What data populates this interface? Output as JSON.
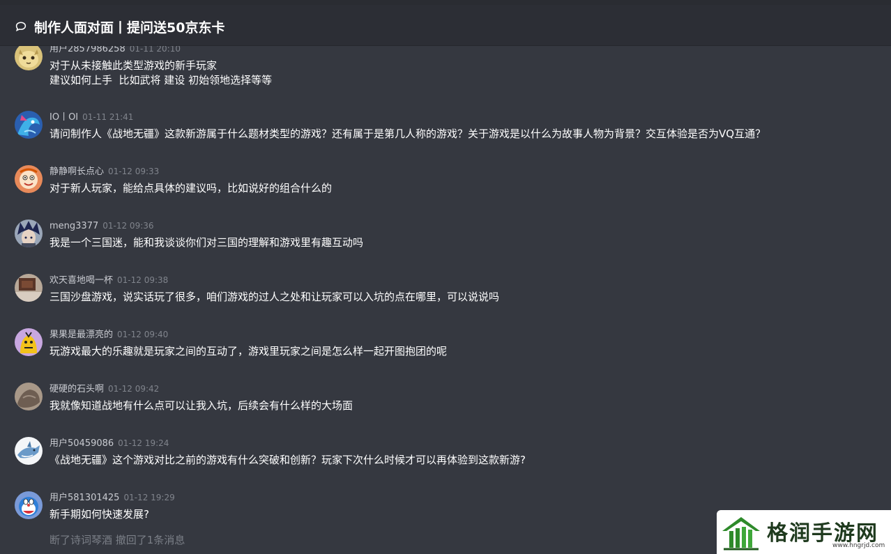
{
  "header": {
    "title": "制作人面对面丨提问送50京东卡",
    "icon": "chat-bubble-icon"
  },
  "messages": [
    {
      "username": "用户2857986258",
      "time": "01-11 20:10",
      "content": "对于从未接触此类型游戏的新手玩家\n建议如何上手  比如武将 建设 初始领地选择等等",
      "avatar": "cat-face-avatar",
      "avatar_color": "#d9c27a"
    },
    {
      "username": "IO丨OI",
      "time": "01-11 21:41",
      "content": "请问制作人《战地无疆》这款新游属于什么题材类型的游戏？还有属于是第几人称的游戏？关于游戏是以什么为故事人物为背景？交互体验是否为VQ互通？",
      "avatar": "blue-dragon-avatar",
      "avatar_color": "#3a7fd0"
    },
    {
      "username": "静静啊长点心",
      "time": "01-12 09:33",
      "content": "对于新人玩家，能给点具体的建议吗，比如说好的组合什么的",
      "avatar": "cartoon-face-avatar",
      "avatar_color": "#e88a5a"
    },
    {
      "username": "meng3377",
      "time": "01-12 09:36",
      "content": "我是一个三国迷，能和我谈谈你们对三国的理解和游戏里有趣互动吗",
      "avatar": "anime-boy-avatar",
      "avatar_color": "#2e3a66"
    },
    {
      "username": "欢天喜地喝一杯",
      "time": "01-12 09:38",
      "content": "三国沙盘游戏，说实话玩了很多，咱们游戏的过人之处和让玩家可以入坑的点在哪里，可以说说吗",
      "avatar": "photo-avatar",
      "avatar_color": "#6b4a3a"
    },
    {
      "username": "果果是最漂亮的",
      "time": "01-12 09:40",
      "content": "玩游戏最大的乐趣就是玩家之间的互动了，游戏里玩家之间是怎么样一起开图抱团的呢",
      "avatar": "yellow-character-avatar",
      "avatar_color": "#c8a7e0"
    },
    {
      "username": "硬硬的石头啊",
      "time": "01-12 09:42",
      "content": "我就像知道战地有什么点可以让我入坑，后续会有什么样的大场面",
      "avatar": "rock-avatar",
      "avatar_color": "#8a7a6e"
    },
    {
      "username": "用户50459086",
      "time": "01-12 19:24",
      "content": "《战地无疆》这个游戏对比之前的游戏有什么突破和创新？玩家下次什么时候才可以再体验到这款新游?",
      "avatar": "shark-avatar",
      "avatar_color": "#eef2f6"
    },
    {
      "username": "用户581301425",
      "time": "01-12 19:29",
      "content": "新手期如何快速发展?",
      "avatar": "doraemon-avatar",
      "avatar_color": "#7a9ad8"
    }
  ],
  "recall_notice": "断了诗词琴酒 撤回了1条消息",
  "watermark": {
    "name": "格润手游网",
    "url": "www.hngrjd.com",
    "logo": "house-logo-icon",
    "color": "#2e8a2a"
  }
}
